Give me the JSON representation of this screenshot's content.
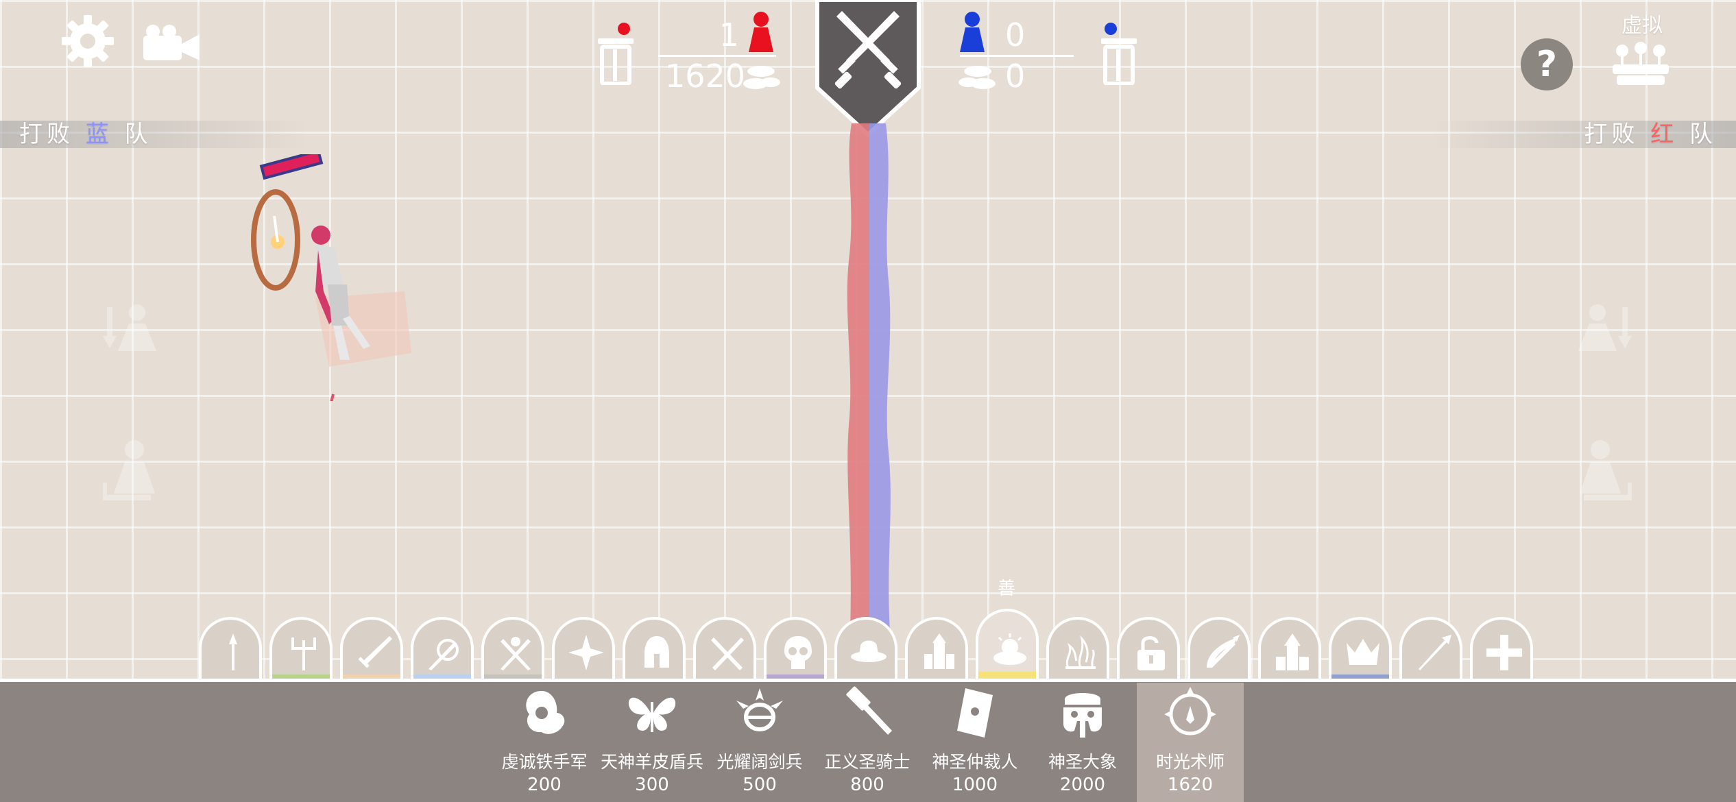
{
  "hud": {
    "red_units": "1",
    "red_cost": "1620",
    "blue_units": "0",
    "blue_cost": "0"
  },
  "banners": {
    "left_prefix": "打败",
    "left_team": "蓝",
    "left_suffix": "队",
    "right_prefix": "打败",
    "right_team": "红",
    "right_suffix": "队"
  },
  "top_right": {
    "virtual_label": "虚拟",
    "help_glyph": "?"
  },
  "faction_tabs": {
    "active_label": "善",
    "tabs": [
      {
        "icon": "spear-icon",
        "color": "#d9d0c8"
      },
      {
        "icon": "trident-icon",
        "color": "#b7d38a"
      },
      {
        "icon": "sword-icon",
        "color": "#f0d2b0"
      },
      {
        "icon": "shield-sword-icon",
        "color": "#b8d2f0"
      },
      {
        "icon": "crossed-axes-icon",
        "color": "#c6c3bd"
      },
      {
        "icon": "shuriken-icon",
        "color": "#d9d0c8"
      },
      {
        "icon": "spartan-helmet-icon",
        "color": "#d9d0c8"
      },
      {
        "icon": "crossed-swords-icon",
        "color": "#d9d0c8"
      },
      {
        "icon": "skull-icon",
        "color": "#b8a8d0"
      },
      {
        "icon": "cowboy-hat-icon",
        "color": "#d9d0c8"
      },
      {
        "icon": "castle-icon",
        "color": "#d9d0c8"
      },
      {
        "icon": "cloud-sun-icon",
        "color": "#f5e27a"
      },
      {
        "icon": "flame-icon",
        "color": "#d9d0c8"
      },
      {
        "icon": "unlock-icon",
        "color": "#d9d0c8"
      },
      {
        "icon": "crossbow-icon",
        "color": "#d9d0c8"
      },
      {
        "icon": "tower-icon",
        "color": "#d9d0c8"
      },
      {
        "icon": "crown-icon",
        "color": "#8fa0d0"
      },
      {
        "icon": "arrow-icon",
        "color": "#d9d0c8"
      },
      {
        "icon": "plus-icon",
        "color": "#d9d0c8"
      }
    ]
  },
  "units": [
    {
      "name": "虔诚铁手军",
      "cost": "200",
      "icon": "iron-fist-icon"
    },
    {
      "name": "天神羊皮盾兵",
      "cost": "300",
      "icon": "butterfly-icon"
    },
    {
      "name": "光耀阔剑兵",
      "cost": "500",
      "icon": "halo-icon"
    },
    {
      "name": "正义圣骑士",
      "cost": "800",
      "icon": "hammer-icon"
    },
    {
      "name": "神圣仲裁人",
      "cost": "1000",
      "icon": "book-icon"
    },
    {
      "name": "神圣大象",
      "cost": "2000",
      "icon": "elephant-icon"
    },
    {
      "name": "时光术师",
      "cost": "1620",
      "icon": "clock-icon",
      "selected": true
    }
  ],
  "colors": {
    "red_team": "#e8111f",
    "blue_team": "#1a3fd8",
    "unit_bar": "#8b8480",
    "ground": "#e6ddd4"
  }
}
